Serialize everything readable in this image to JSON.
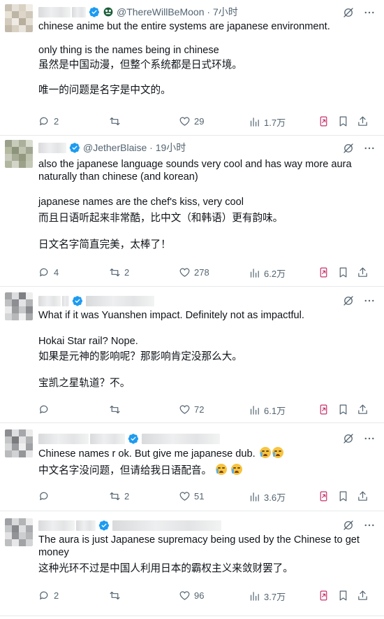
{
  "posts": [
    {
      "handle": "@ThereWillBeMoon",
      "time": "7小时",
      "lines": [
        "chinese anime but the entire systems are japanese environment.",
        "",
        "only thing is the names being in chinese",
        "虽然是中国动漫，但整个系统都是日式环境。",
        "",
        "唯一的问题是名字是中文的。"
      ],
      "replies": "2",
      "reposts": "",
      "likes": "29",
      "views": "1.7万"
    },
    {
      "handle": "@JetherBlaise",
      "time": "19小时",
      "lines": [
        "also the japanese language sounds very cool and has way more aura",
        "naturally than chinese (and korean)",
        "",
        "japanese names are the chef's kiss, very cool",
        "而且日语听起来非常酷，比中文（和韩语）更有韵味。",
        "",
        "日文名字简直完美，太棒了！"
      ],
      "replies": "4",
      "reposts": "2",
      "likes": "278",
      "views": "6.2万"
    },
    {
      "handle": "",
      "time": "",
      "lines": [
        "What if it was Yuanshen impact. Definitely not as impactful.",
        "",
        "Hokai Star rail? Nope.",
        "如果是元神的影响呢？那影响肯定没那么大。",
        "",
        "宝凯之星轨道？不。"
      ],
      "replies": "",
      "reposts": "",
      "likes": "72",
      "views": "6.1万"
    },
    {
      "handle": "",
      "time": "",
      "lines": [
        "Chinese names r ok. But give me japanese dub.",
        "中文名字没问题，但请给我日语配音。"
      ],
      "replies": "",
      "reposts": "2",
      "likes": "51",
      "views": "3.6万"
    },
    {
      "handle": "",
      "time": "",
      "lines": [
        "The aura is just Japanese supremacy being used by the Chinese to get",
        "money",
        "这种光环不过是中国人利用日本的霸权主义来敛财罢了。"
      ],
      "replies": "2",
      "reposts": "",
      "likes": "96",
      "views": "3.7万"
    }
  ],
  "colors": {
    "verified": "#1d9bf0",
    "accent_pink": "#c8326b",
    "muted": "#536471"
  },
  "icons": [
    "verified-badge-icon",
    "grok-icon",
    "more-icon",
    "reply-icon",
    "repost-icon",
    "like-icon",
    "views-icon",
    "grok-analyze-icon",
    "bookmark-icon",
    "share-icon"
  ]
}
